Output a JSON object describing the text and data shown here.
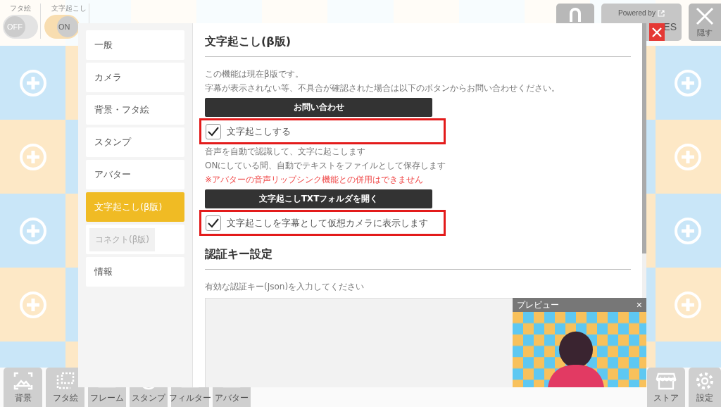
{
  "top_toggles": [
    {
      "label": "フタ絵",
      "state_text": "OFF",
      "on": false
    },
    {
      "label": "文字起こし",
      "state_text": "ON",
      "on": true
    }
  ],
  "top_buttons": [
    {
      "kind": "home"
    },
    {
      "kind": "powered",
      "label": "Powered by",
      "sublabel": "ES"
    },
    {
      "kind": "hide",
      "label": "隠す"
    }
  ],
  "bottom_toolbar": [
    {
      "kind": "background",
      "label": "背景"
    },
    {
      "kind": "lid",
      "label": "フタ絵"
    },
    {
      "kind": "frame",
      "label": "フレーム"
    },
    {
      "kind": "stamp",
      "label": "スタンプ"
    },
    {
      "kind": "filter",
      "label": "フィルター"
    },
    {
      "kind": "avatar",
      "label": "アバター"
    }
  ],
  "bottom_right_toolbar": [
    {
      "kind": "store",
      "label": "ストア"
    },
    {
      "kind": "settings",
      "label": "設定"
    }
  ],
  "settings_dialog": {
    "sidebar": {
      "items": [
        {
          "label": "一般",
          "selected": false,
          "disabled": false
        },
        {
          "label": "カメラ",
          "selected": false,
          "disabled": false
        },
        {
          "label": "背景・フタ絵",
          "selected": false,
          "disabled": false
        },
        {
          "label": "スタンプ",
          "selected": false,
          "disabled": false
        },
        {
          "label": "アバター",
          "selected": false,
          "disabled": false
        },
        {
          "label": "文字起こし(β版)",
          "selected": true,
          "disabled": false
        },
        {
          "label": "コネクト(β版)",
          "selected": false,
          "disabled": true
        },
        {
          "label": "情報",
          "selected": false,
          "disabled": false
        }
      ]
    },
    "sections": [
      {
        "title": "文字起こし(β版)",
        "blocks": [
          {
            "kind": "text",
            "text": "この機能は現在β版です。"
          },
          {
            "kind": "text",
            "text": "字幕が表示されない等、不具合が確認された場合は以下のボタンからお問い合わせください。"
          },
          {
            "kind": "button",
            "text": "お問い合わせ"
          },
          {
            "kind": "checkbox",
            "text": "文字起こしする",
            "checked": true,
            "highlighted": true
          },
          {
            "kind": "text",
            "text": "音声を自動で認識して、文字に起こします"
          },
          {
            "kind": "text",
            "text": "ONにしている間、自動でテキストをファイルとして保存します"
          },
          {
            "kind": "warning",
            "text": "※アバターの音声リップシンク機能との併用はできません"
          },
          {
            "kind": "button",
            "text": "文字起こしTXTフォルダを開く"
          },
          {
            "kind": "checkbox",
            "text": "文字起こしを字幕として仮想カメラに表示します",
            "checked": true,
            "highlighted": true
          }
        ]
      },
      {
        "title": "認証キー設定",
        "blocks": [
          {
            "kind": "text",
            "text": "有効な認証キー(Json)を入力してください"
          },
          {
            "kind": "textarea"
          }
        ]
      }
    ],
    "preview": {
      "title": "プレビュー",
      "close": "×"
    }
  }
}
